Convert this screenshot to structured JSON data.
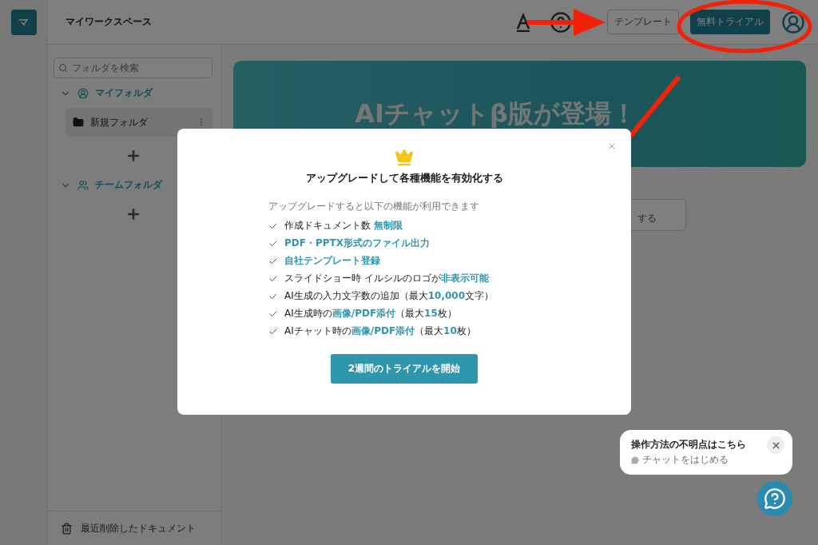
{
  "rail": {
    "avatar_letter": "マ"
  },
  "header": {
    "title": "マイワークスペース",
    "template_button": "テンプレート",
    "trial_button": "無料トライアル"
  },
  "sidebar": {
    "search": {
      "placeholder": "フォルダを検索"
    },
    "sections": [
      {
        "label": "マイフォルダ",
        "kind": "personal",
        "expanded": true,
        "folders": [
          {
            "name": "新規フォルダ",
            "selected": true
          }
        ]
      },
      {
        "label": "チームフォルダ",
        "kind": "team",
        "expanded": true
      }
    ],
    "trash": "最近削除したドキュメント"
  },
  "banner": {
    "title": "AIチャットβ版が登場！"
  },
  "card": {
    "text": "する"
  },
  "modal": {
    "title": "アップグレードして各種機能を有効化する",
    "subtitle": "アップグレードすると以下の機能が利用できます",
    "features": [
      {
        "text": "作成ドキュメント数 **無制限**",
        "emphasis": false
      },
      {
        "text": "PDF・PPTX形式のファイル出力",
        "emphasis": true
      },
      {
        "text": "自社テンプレート登録",
        "emphasis": true
      },
      {
        "text": "スライドショー時 イルシルのロゴが**非表示可能**",
        "emphasis": false
      },
      {
        "text": "AI生成の入力文字数の追加（最大**10,000**文字）",
        "emphasis": false
      },
      {
        "text": "AI生成時の**画像/PDF添付**（最大**15**枚）",
        "emphasis": false
      },
      {
        "text": "AIチャット時の**画像/PDF添付**（最大**10**枚）",
        "emphasis": false
      }
    ],
    "button": "2週間のトライアルを開始"
  },
  "chat_popup": {
    "title": "操作方法の不明点はこちら",
    "subtitle": "チャットをはじめる"
  }
}
